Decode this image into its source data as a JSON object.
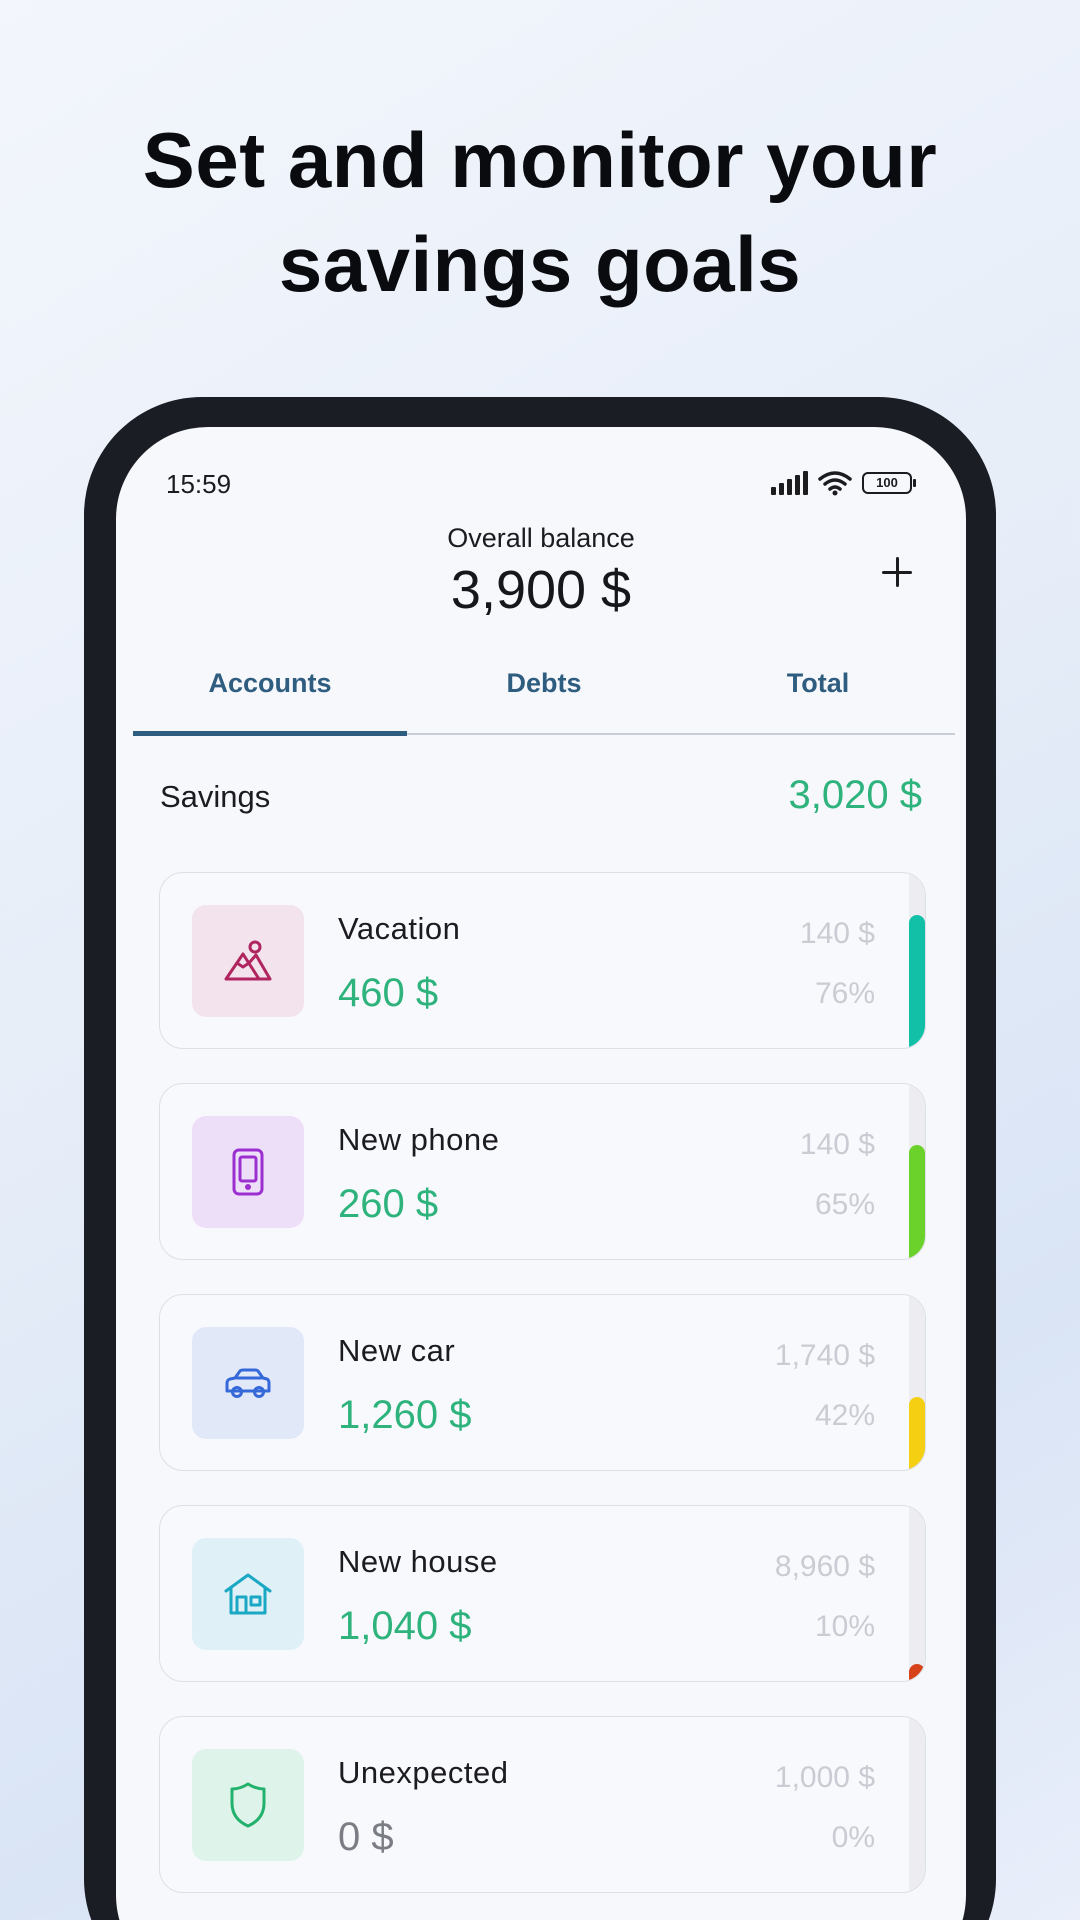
{
  "headline": {
    "line1": "Set and monitor your",
    "line2": "savings goals"
  },
  "status_bar": {
    "time": "15:59",
    "battery": "100",
    "icons": [
      "signal-icon",
      "wifi-icon",
      "battery-icon"
    ]
  },
  "header": {
    "balance_label": "Overall balance",
    "balance_value": "3,900 $",
    "add_icon": "plus-icon"
  },
  "tabs": [
    {
      "label": "Accounts",
      "active": true
    },
    {
      "label": "Debts",
      "active": false
    },
    {
      "label": "Total",
      "active": false
    }
  ],
  "section": {
    "label": "Savings",
    "total": "3,020 $"
  },
  "colors": {
    "accent": "#2f5d80",
    "positive": "#2fb37d",
    "muted": "#c9ccd2"
  },
  "goals": [
    {
      "name": "Vacation",
      "saved": "460 $",
      "remaining": "140 $",
      "percent_label": "76%",
      "progress": 0.76,
      "icon": "mountain-icon",
      "icon_color": "#b0255f",
      "icon_bg": "#f2e3ec",
      "bar_color": "#12c0a7"
    },
    {
      "name": "New phone",
      "saved": "260 $",
      "remaining": "140 $",
      "percent_label": "65%",
      "progress": 0.65,
      "icon": "phone-icon",
      "icon_color": "#9b2fcf",
      "icon_bg": "#eedff9",
      "bar_color": "#6ad22a"
    },
    {
      "name": "New car",
      "saved": "1,260 $",
      "remaining": "1,740 $",
      "percent_label": "42%",
      "progress": 0.42,
      "icon": "car-icon",
      "icon_color": "#3568d8",
      "icon_bg": "#e1e8f8",
      "bar_color": "#f5cf12"
    },
    {
      "name": "New house",
      "saved": "1,040 $",
      "remaining": "8,960 $",
      "percent_label": "10%",
      "progress": 0.1,
      "icon": "house-icon",
      "icon_color": "#1aa8c4",
      "icon_bg": "#dff0f7",
      "bar_color": "#d6421a"
    },
    {
      "name": "Unexpected",
      "saved": "0 $",
      "remaining": "1,000 $",
      "percent_label": "0%",
      "progress": 0,
      "icon": "shield-icon",
      "icon_color": "#23b26b",
      "icon_bg": "#def3ea",
      "bar_color": "#c9ccd2"
    }
  ]
}
